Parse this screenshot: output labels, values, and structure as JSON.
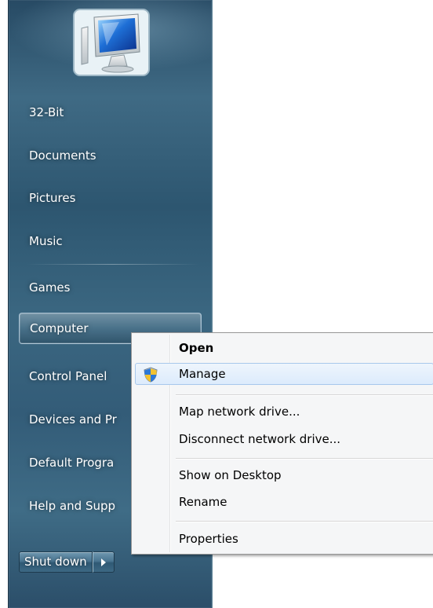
{
  "start_menu": {
    "items": [
      {
        "label": "32-Bit"
      },
      {
        "label": "Documents"
      },
      {
        "label": "Pictures"
      },
      {
        "label": "Music"
      },
      {
        "label": "Games"
      },
      {
        "label": "Computer"
      },
      {
        "label": "Control Panel"
      },
      {
        "label": "Devices and Pr"
      },
      {
        "label": "Default Progra"
      },
      {
        "label": "Help and Supp"
      }
    ],
    "shutdown_label": "Shut down",
    "icons": {
      "user_picture": "computer-monitor-icon",
      "shutdown_options": "arrow-right-icon"
    }
  },
  "context_menu": {
    "items": [
      {
        "label": "Open",
        "bold": true
      },
      {
        "label": "Manage",
        "icon": "uac-shield-icon",
        "highlighted": true
      },
      {
        "label": "Map network drive..."
      },
      {
        "label": "Disconnect network drive..."
      },
      {
        "label": "Show on Desktop"
      },
      {
        "label": "Rename"
      },
      {
        "label": "Properties"
      }
    ]
  },
  "colors": {
    "start_menu_bg": "#2d5670",
    "context_menu_bg": "#f5f6f7",
    "hover_border": "#a8c8ec"
  }
}
